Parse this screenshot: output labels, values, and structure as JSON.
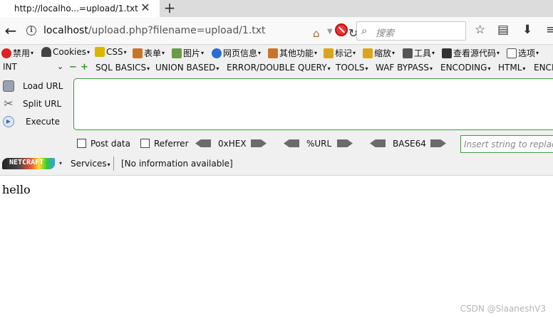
{
  "tab": {
    "title": "http://localho...=upload/1.txt",
    "close": "✕",
    "new_tab": "+"
  },
  "nav": {
    "url_host": "localhost",
    "url_path": "/upload.php?filename=upload/1.txt",
    "search_placeholder": "搜索"
  },
  "menubar": {
    "items": [
      "禁用",
      "Cookies",
      "CSS",
      "表单",
      "图片",
      "网页信息",
      "其他功能",
      "标记",
      "缩放",
      "工具",
      "查看源代码",
      "选项"
    ]
  },
  "hackbar": {
    "type_select": "INT",
    "items": [
      "SQL BASICS",
      "UNION BASED",
      "ERROR/DOUBLE QUERY",
      "TOOLS",
      "WAF BYPASS",
      "ENCODING",
      "HTML",
      "ENCI"
    ]
  },
  "actions": {
    "load_url": "Load URL",
    "split_url": "Split URL",
    "execute": "Execute"
  },
  "options": {
    "post_data": "Post data",
    "referrer": "Referrer",
    "hex": "0xHEX",
    "url": "%URL",
    "base64": "BASE64",
    "insert_placeholder": "Insert string to replace"
  },
  "status": {
    "netcraft": "NETCRAFT",
    "services": "Services",
    "info": "[No information available]"
  },
  "page": {
    "body_text": "hello",
    "watermark": "CSDN @SlaaneshV3"
  }
}
